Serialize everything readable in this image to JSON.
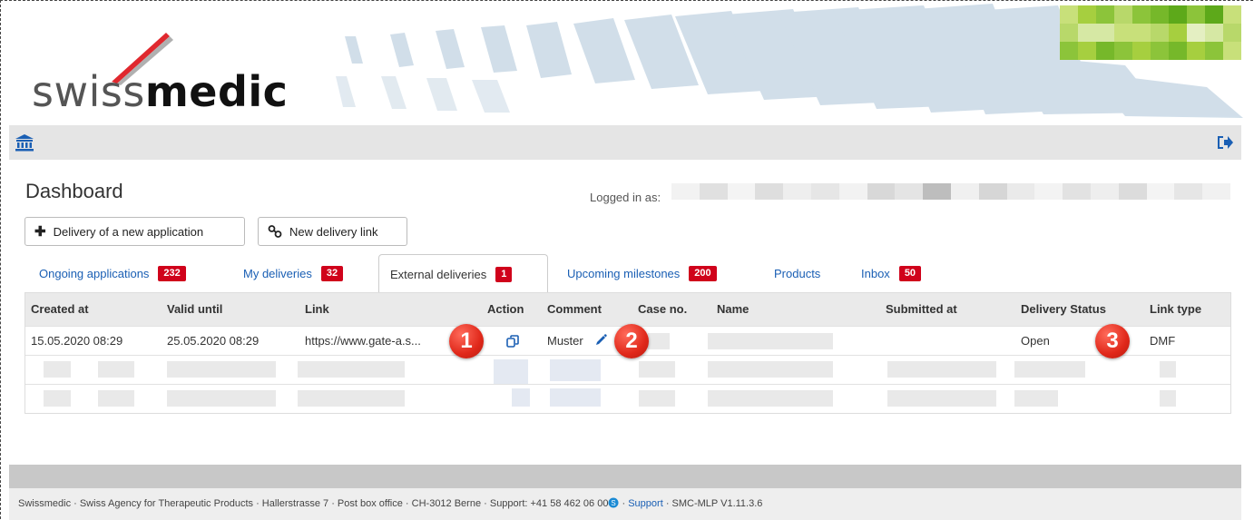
{
  "header": {
    "logo_light": "swiss",
    "logo_bold": "medic"
  },
  "navbar": {
    "home_icon": "bank-building-icon",
    "logout_icon": "logout-arrow-icon"
  },
  "page": {
    "title": "Dashboard",
    "logged_in_label": "Logged in as:"
  },
  "buttons": {
    "new_application": "Delivery of a new application",
    "new_link": "New delivery link"
  },
  "tabs": [
    {
      "label": "Ongoing applications",
      "count": "232"
    },
    {
      "label": "My deliveries",
      "count": "32"
    },
    {
      "label": "External deliveries",
      "count": "1"
    },
    {
      "label": "Upcoming milestones",
      "count": "200"
    },
    {
      "label": "Products",
      "count": ""
    },
    {
      "label": "Inbox",
      "count": "50"
    }
  ],
  "table": {
    "columns": [
      "Created at",
      "Valid until",
      "Link",
      "Action",
      "Comment",
      "Case no.",
      "Name",
      "Submitted at",
      "Delivery Status",
      "Link type"
    ],
    "rows": [
      {
        "created_at": "15.05.2020 08:29",
        "valid_until": "25.05.2020 08:29",
        "link": "https://www.gate-a.s...",
        "comment": "Muster",
        "delivery_status": "Open",
        "link_type": "DMF"
      }
    ]
  },
  "markers": [
    "1",
    "2",
    "3"
  ],
  "footer": {
    "text": "Swissmedic · Swiss Agency for Therapeutic Products · Hallerstrasse 7 · Post box office · CH-3012 Berne · Support: +41 58 462 06 00",
    "support_link": "Support",
    "version": "· SMC-MLP V1.11.3.6"
  },
  "colors": {
    "brand_red": "#d0021b",
    "link_blue": "#1a5fb4",
    "nav_gray": "#e5e5e5"
  }
}
